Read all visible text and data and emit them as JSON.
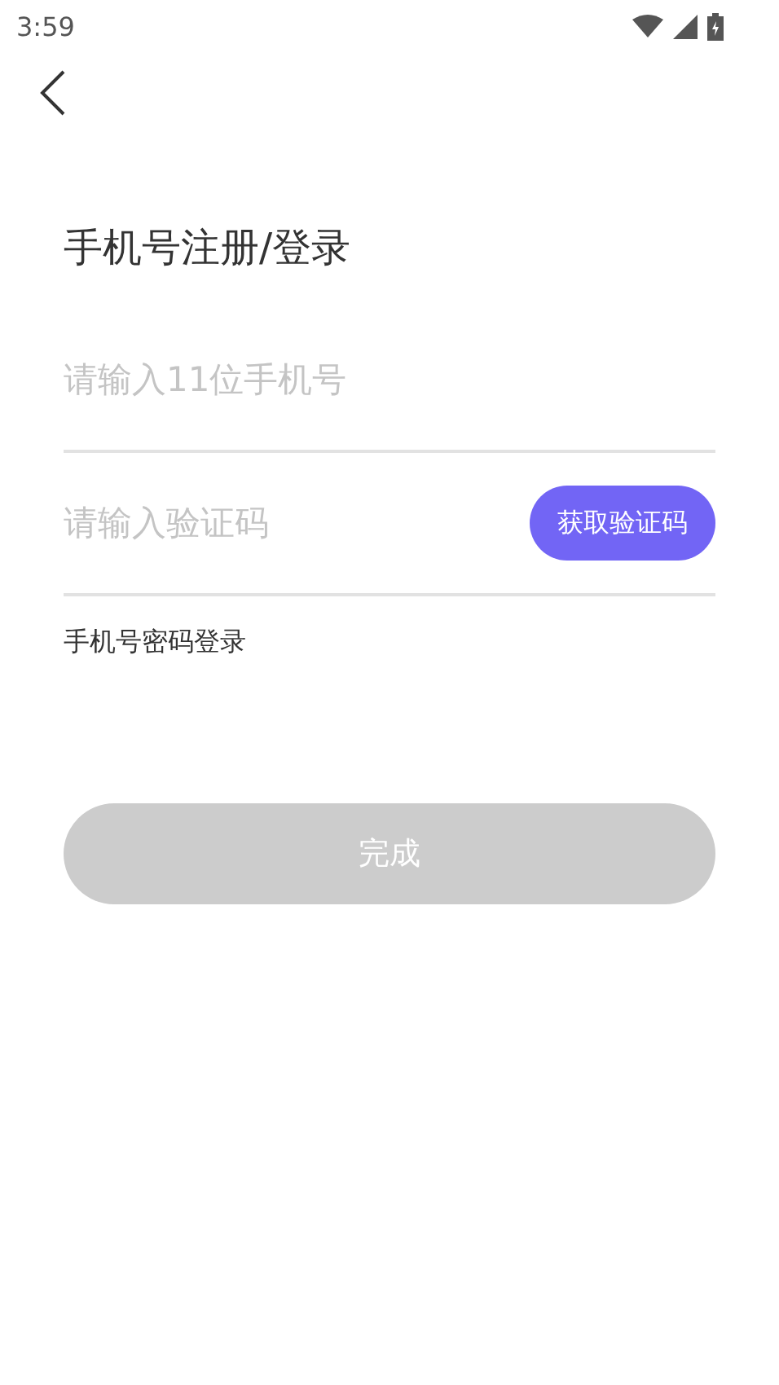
{
  "status_bar": {
    "time": "3:59"
  },
  "title": "手机号注册/登录",
  "phone_field": {
    "placeholder": "请输入11位手机号"
  },
  "code_field": {
    "placeholder": "请输入验证码"
  },
  "get_code_button": {
    "label": "获取验证码",
    "disabled": false
  },
  "password_login_link": "手机号密码登录",
  "submit_button": {
    "label": "完成",
    "disabled": true
  }
}
